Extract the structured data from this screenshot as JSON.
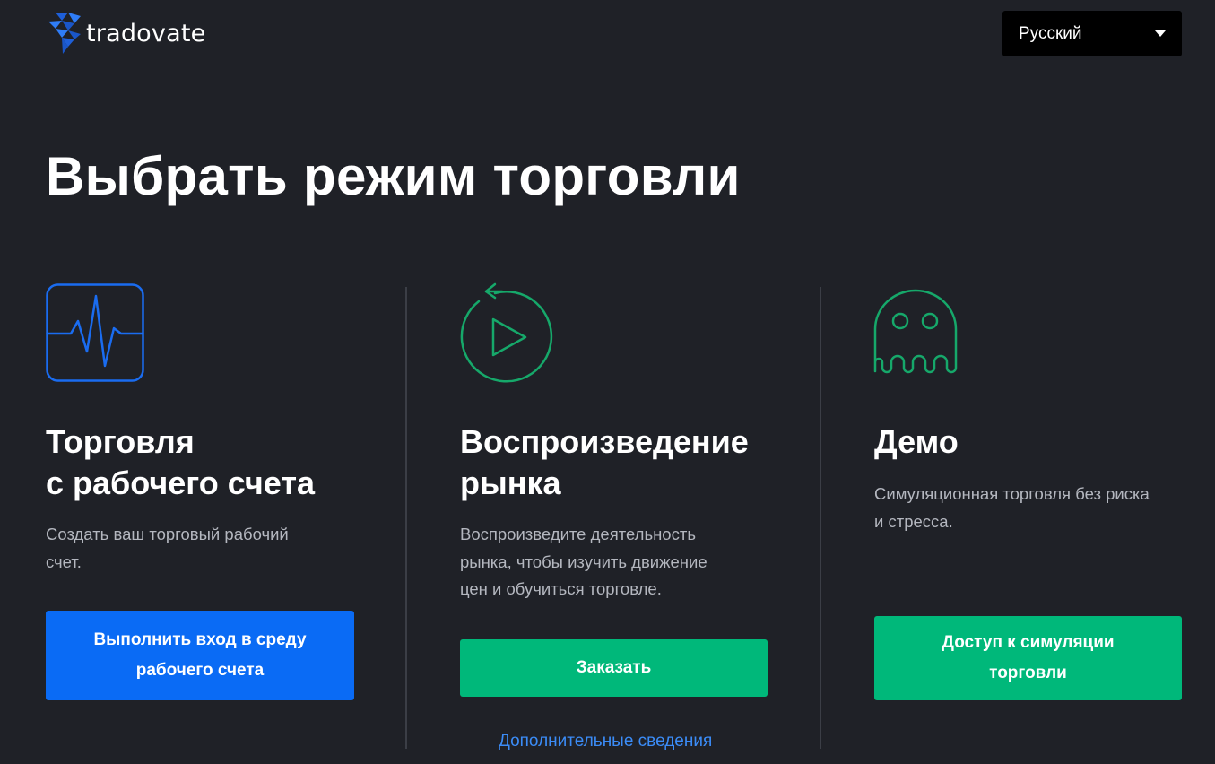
{
  "header": {
    "logo_text": "tradovate",
    "language": {
      "selected": "Русский"
    }
  },
  "page_title": "Выбрать режим торговли",
  "columns": [
    {
      "icon": "heartbeat-monitor-icon",
      "heading": [
        "Торговля",
        "с рабочего счета"
      ],
      "description": [
        "Создать ваш торговый рабочий",
        "счет."
      ],
      "button": [
        "Выполнить вход в среду",
        "рабочего счета"
      ]
    },
    {
      "icon": "replay-play-icon",
      "heading": [
        "Воспроизведение",
        "рынка"
      ],
      "description": [
        "Воспроизведите деятельность",
        "рынка, чтобы изучить движение",
        "цен и обучиться торговле."
      ],
      "button": [
        "Заказать"
      ],
      "link": "Дополнительные сведения"
    },
    {
      "icon": "ghost-icon",
      "heading": [
        "Демо"
      ],
      "description": [
        "Симуляционная торговля без риска",
        "и стресса."
      ],
      "button": [
        "Доступ к симуляции",
        "торговли"
      ]
    }
  ],
  "colors": {
    "background": "#1f2127",
    "blue": "#0a6bf5",
    "green": "#00b87a",
    "link": "#3b8cf7",
    "icon_green": "#16a86a"
  }
}
